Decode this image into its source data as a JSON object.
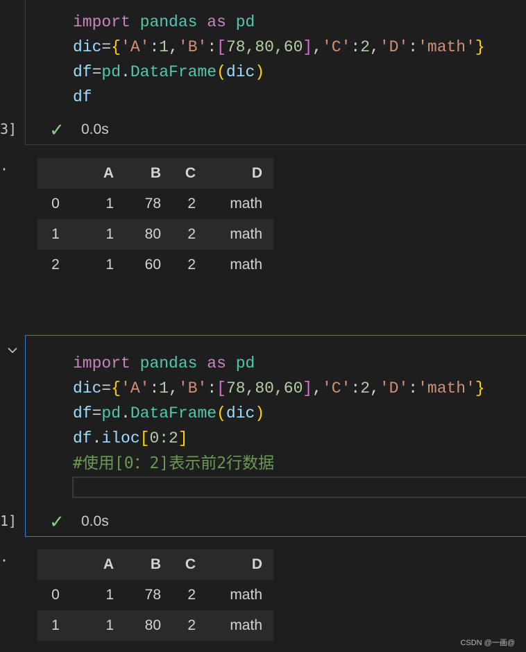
{
  "cells": [
    {
      "exec_count": "3]",
      "code_lines": [
        [
          "import",
          " ",
          "pandas",
          " ",
          "as",
          " ",
          "pd"
        ],
        [
          "dic",
          "=",
          "{",
          "'A'",
          ":",
          "1",
          ",",
          "'B'",
          ":",
          "[",
          "78,80,60",
          "]",
          ",",
          "'C'",
          ":",
          "2",
          ",",
          "'D'",
          ":",
          "'math'",
          "}"
        ],
        [
          "df",
          "=",
          "pd",
          ".",
          "DataFrame",
          "(",
          "dic",
          ")"
        ],
        [
          "df"
        ]
      ],
      "status_text": "0.0s",
      "output": {
        "columns": [
          "",
          "A",
          "B",
          "C",
          "D"
        ],
        "rows": [
          [
            "0",
            "1",
            "78",
            "2",
            "math"
          ],
          [
            "1",
            "1",
            "80",
            "2",
            "math"
          ],
          [
            "2",
            "1",
            "60",
            "2",
            "math"
          ]
        ]
      }
    },
    {
      "exec_count": "1]",
      "code_lines": [
        [
          "import",
          " ",
          "pandas",
          " ",
          "as",
          " ",
          "pd"
        ],
        [
          "dic",
          "=",
          "{",
          "'A'",
          ":",
          "1",
          ",",
          "'B'",
          ":",
          "[",
          "78,80,60",
          "]",
          ",",
          "'C'",
          ":",
          "2",
          ",",
          "'D'",
          ":",
          "'math'",
          "}"
        ],
        [
          "df",
          "=",
          "pd",
          ".",
          "DataFrame",
          "(",
          "dic",
          ")"
        ],
        [
          "df",
          ".",
          "iloc",
          "[",
          "0:2",
          "]"
        ]
      ],
      "comment": "#使用[0：2]表示前2行数据",
      "status_text": "0.0s",
      "output": {
        "columns": [
          "",
          "A",
          "B",
          "C",
          "D"
        ],
        "rows": [
          [
            "0",
            "1",
            "78",
            "2",
            "math"
          ],
          [
            "1",
            "1",
            "80",
            "2",
            "math"
          ]
        ]
      }
    }
  ],
  "icons": {
    "check": "check-icon",
    "chevron": "chevron-down-icon"
  },
  "colors": {
    "focus_border": "#2f7ed8",
    "check": "#89d185",
    "background": "#1e1e1e"
  },
  "watermark": "CSDN @一画@"
}
